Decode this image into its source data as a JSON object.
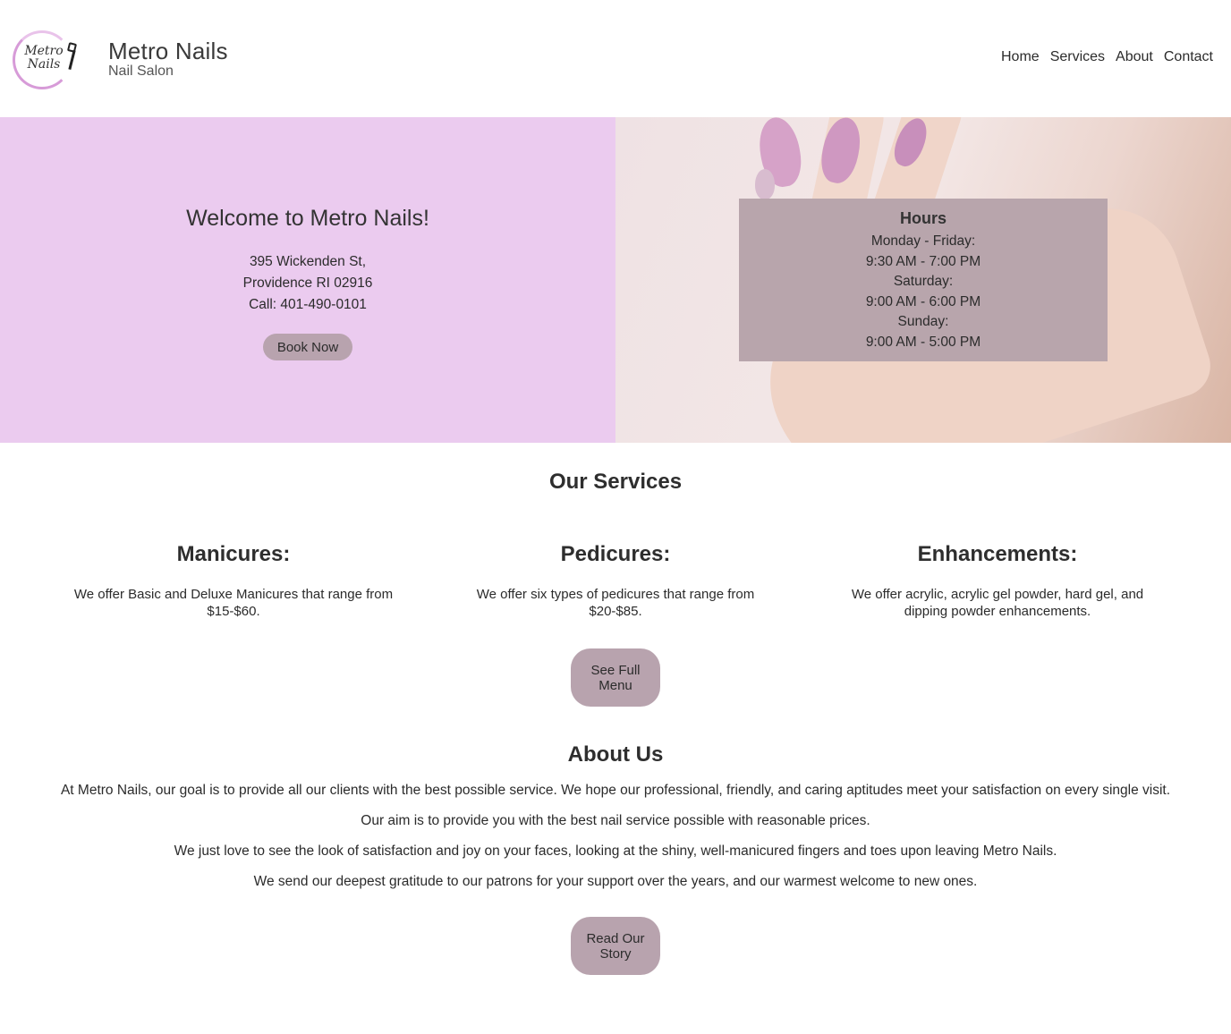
{
  "header": {
    "logo_text_line1": "Metro",
    "logo_text_line2": "Nails",
    "brand_title": "Metro Nails",
    "brand_subtitle": "Nail Salon",
    "nav": [
      "Home",
      "Services",
      "About",
      "Contact"
    ]
  },
  "hero": {
    "welcome": "Welcome to Metro Nails!",
    "address_line1": "395 Wickenden St,",
    "address_line2": "Providence RI 02916",
    "phone": "Call: 401-490-0101",
    "book_button": "Book Now",
    "hours": {
      "title": "Hours",
      "lines": [
        "Monday - Friday:",
        "9:30 AM - 7:00 PM",
        "Saturday:",
        "9:00 AM - 6:00 PM",
        "Sunday:",
        "9:00 AM - 5:00 PM"
      ]
    }
  },
  "services": {
    "title": "Our Services",
    "items": [
      {
        "title": "Manicures:",
        "text": "We offer Basic and Deluxe Manicures that range from $15-$60."
      },
      {
        "title": "Pedicures:",
        "text": "We offer six types of pedicures that range from $20-$85."
      },
      {
        "title": "Enhancements:",
        "text": "We offer acrylic, acrylic gel powder, hard gel, and dipping powder enhancements."
      }
    ],
    "menu_button_line1": "See Full",
    "menu_button_line2": "Menu"
  },
  "about": {
    "title": "About Us",
    "paragraphs": [
      "At Metro Nails, our goal is to provide all our clients with the best possible service. We hope our professional, friendly, and caring aptitudes meet your satisfaction on every single visit.",
      "Our aim is to provide you with the best nail service possible with reasonable prices.",
      "We just love to see the look of satisfaction and joy on your faces, looking at the shiny, well-manicured fingers and toes upon leaving Metro Nails.",
      "We send our deepest gratitude to our patrons for your support over the years, and our warmest welcome to new ones."
    ],
    "story_button_line1": "Read Our",
    "story_button_line2": "Story"
  },
  "colors": {
    "hero_left_bg": "#ebcbef",
    "button_bg": "#b8a3ae",
    "hours_bg": "#b8a5ac",
    "logo_ring": "#d79bd8"
  }
}
